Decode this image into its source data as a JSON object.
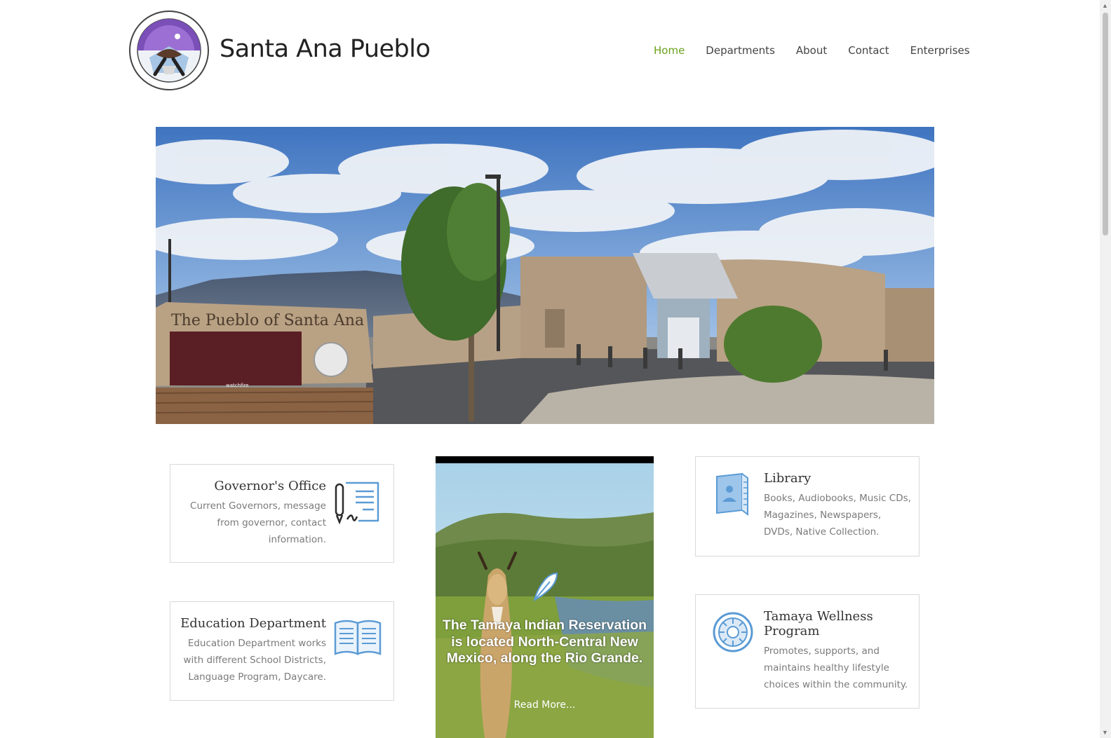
{
  "header": {
    "site_title": "Santa Ana Pueblo",
    "nav": [
      {
        "label": "Home",
        "active": true
      },
      {
        "label": "Departments",
        "active": false
      },
      {
        "label": "About",
        "active": false
      },
      {
        "label": "Contact",
        "active": false
      },
      {
        "label": "Enterprises",
        "active": false
      }
    ]
  },
  "hero": {
    "sign_text": "The Pueblo of Santa Ana",
    "sign_brand": "watchfire"
  },
  "cards": {
    "governors_office": {
      "title": "Governor's Office",
      "description": "Current Governors, message from governor, contact information.",
      "icon": "signed-document-icon"
    },
    "education": {
      "title": "Education Department",
      "description": "Education Department works with different School Districts, Language Program, Daycare.",
      "icon": "open-book-icon"
    },
    "library": {
      "title": "Library",
      "description": "Books, Audiobooks, Music CDs, Magazines, Newspapers, DVDs, Native Collection.",
      "icon": "library-book-icon"
    },
    "wellness": {
      "title": "Tamaya Wellness Program",
      "description": "Promotes, supports, and maintains healthy lifestyle choices within the community.",
      "icon": "wellness-emblem-icon"
    }
  },
  "feature": {
    "caption": "The Tamaya Indian Reservation is located North-Central New Mexico, along the Rio Grande.",
    "link_label": "Read More...",
    "icon": "feather-icon"
  },
  "colors": {
    "nav_active": "#6aa11c",
    "icon_blue": "#5b9bd5"
  }
}
